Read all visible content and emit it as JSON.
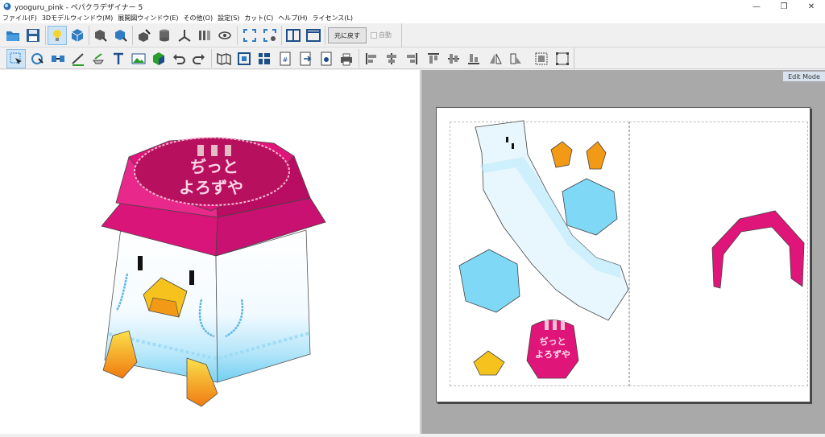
{
  "window": {
    "title": "yooguru_pink - ペパクラデザイナー 5",
    "minimize": "—",
    "restore": "❐",
    "close": "✕"
  },
  "menu": [
    "ファイル(F)",
    "3Dモデルウィンドウ(M)",
    "展開図ウィンドウ(E)",
    "その他(O)",
    "設定(S)",
    "カット(C)",
    "ヘルプ(H)",
    "ライセンス(L)"
  ],
  "toolbar": {
    "revert_label": "元に戻す",
    "auto_label": "自動"
  },
  "view2d": {
    "mode_label": "Edit Mode"
  },
  "model": {
    "top_text_line1": "ぢっと",
    "top_text_line2": "よろずや",
    "badge_line1": "ぢっと",
    "badge_line2": "よろずや"
  },
  "colors": {
    "magenta": "#e0157a",
    "dark_magenta": "#b30c5a",
    "sky": "#7fd8f6",
    "orange": "#f29a15"
  }
}
